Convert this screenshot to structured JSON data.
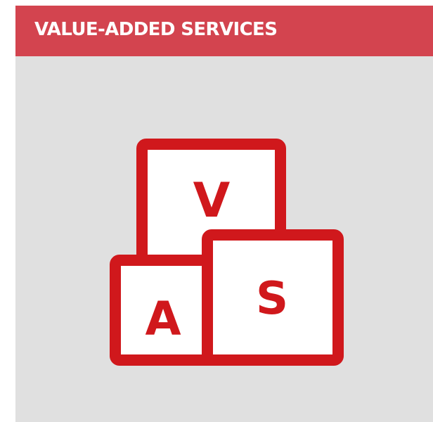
{
  "header": {
    "title": "VALUE-ADDED SERVICES",
    "background_color": "#d3444f",
    "text_color": "#ffffff"
  },
  "card": {
    "background_color": "#e0e0e0"
  },
  "icon": {
    "name": "vas-blocks-icon",
    "stroke_color": "#d0181c",
    "fill_color": "#ffffff",
    "letters": {
      "top": "V",
      "left": "A",
      "right": "S"
    }
  }
}
